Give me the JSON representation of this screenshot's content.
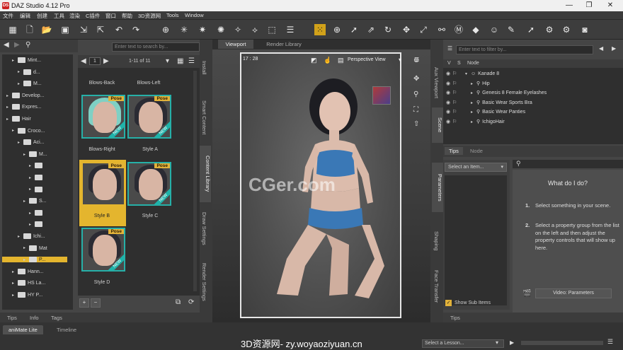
{
  "app": {
    "title": "DAZ Studio 4.12 Pro",
    "icon_text": "DS"
  },
  "window_controls": {
    "minimize": "—",
    "maximize": "❐",
    "close": "✕"
  },
  "menu": [
    "文件",
    "编辑",
    "创建",
    "工具",
    "渲染",
    "C插件",
    "窗口",
    "帮助",
    "3D资源网",
    "Tools",
    "Window"
  ],
  "toolbar_icons": [
    "new-file-icon",
    "new-file-icon",
    "open-folder-icon",
    "save-icon",
    "merge-icon",
    "export-icon",
    "undo-icon",
    "redo-icon",
    "add-figure-icon",
    "light-icon",
    "spotlight-icon",
    "camera-light-icon",
    "node-icon",
    "universal-tool-icon",
    "texture-icon",
    "select-icon",
    "node-select-icon",
    "rotate-icon",
    "translate-icon",
    "scale-icon",
    "joint-editor-icon",
    "surface-icon",
    "paint-icon",
    "morph-icon",
    "render-settings-icon",
    "render-icon",
    "camera-icon"
  ],
  "content_library": {
    "search_placeholder": "Enter text to search by...",
    "page": "1",
    "range": "1-11 of 11",
    "tree": [
      {
        "label": "Mint...",
        "depth": 4
      },
      {
        "label": "d...",
        "depth": 5
      },
      {
        "label": "M...",
        "depth": 5
      },
      {
        "label": "Develop...",
        "depth": 3
      },
      {
        "label": "Expres...",
        "depth": 3
      },
      {
        "label": "Hair",
        "depth": 3
      },
      {
        "label": "Croco...",
        "depth": 4
      },
      {
        "label": "Aci...",
        "depth": 5
      },
      {
        "label": "M...",
        "depth": 6
      },
      {
        "label": "",
        "depth": 7
      },
      {
        "label": "",
        "depth": 7
      },
      {
        "label": "",
        "depth": 7
      },
      {
        "label": "S...",
        "depth": 6
      },
      {
        "label": "",
        "depth": 7
      },
      {
        "label": "",
        "depth": 7
      },
      {
        "label": "Ichi...",
        "depth": 5
      },
      {
        "label": "Mat",
        "depth": 6
      },
      {
        "label": "P...",
        "depth": 6,
        "selected": true
      },
      {
        "label": "Hann...",
        "depth": 4
      },
      {
        "label": "HS La...",
        "depth": 4
      },
      {
        "label": "HY P...",
        "depth": 4
      }
    ],
    "items": [
      {
        "caption": "Blows-Back"
      },
      {
        "caption": "Blows-Left"
      },
      {
        "caption": "Blows-Right",
        "badge": "Pose",
        "new": "NEW"
      },
      {
        "caption": "Style A",
        "badge": "Pose",
        "new": "NEW"
      },
      {
        "caption": "Style B",
        "badge": "Pose",
        "selected": true
      },
      {
        "caption": "Style C",
        "badge": "Pose",
        "new": "NEW"
      },
      {
        "caption": "Style D",
        "badge": "Pose",
        "new": "NEW"
      }
    ],
    "side_tabs": [
      "Install",
      "Smart Content",
      "Content Library",
      "Draw Settings",
      "Render Settings"
    ],
    "bottom_tabs": [
      "Tips",
      "Info",
      "Tags"
    ]
  },
  "viewport": {
    "tabs": [
      "Viewport",
      "Render Library"
    ],
    "time": "17 : 28",
    "view": "Perspective View",
    "watermark": "CGer.com"
  },
  "scene": {
    "filter_placeholder": "Enter text to filter by...",
    "column_node": "Node",
    "col_v": "V",
    "col_s": "S",
    "nodes": [
      {
        "label": "Kanade 8",
        "depth": 0
      },
      {
        "label": "Hip",
        "depth": 1
      },
      {
        "label": "Genesis 8 Female Eyelashes",
        "depth": 1
      },
      {
        "label": "Basic Wear Sports Bra",
        "depth": 1
      },
      {
        "label": "Basic Wear Panties",
        "depth": 1
      },
      {
        "label": "IchigoHair",
        "depth": 1
      }
    ],
    "side_tabs": [
      "Aux Viewport",
      "Scene"
    ]
  },
  "parameters": {
    "tabs": [
      "Tips",
      "Node"
    ],
    "select_item": "Select an Item...",
    "show_sub_items": "Show Sub Items",
    "side_tabs": [
      "Parameters",
      "Shaping",
      "Face Transfer"
    ],
    "help_title": "What do I do?",
    "step1_num": "1.",
    "step1": "Select something in your scene.",
    "step2_num": "2.",
    "step2": "Select a property group from the list on the left and then adjust the property controls that will show up here.",
    "video_button": "Video: Parameters",
    "bottom_tab": "Tips"
  },
  "bottom": {
    "tabs": [
      "aniMate Lite",
      "Timeline"
    ],
    "footer_watermark": "3D资源网- zy.woyaoziyuan.cn",
    "lesson": "Select a Lesson..."
  }
}
